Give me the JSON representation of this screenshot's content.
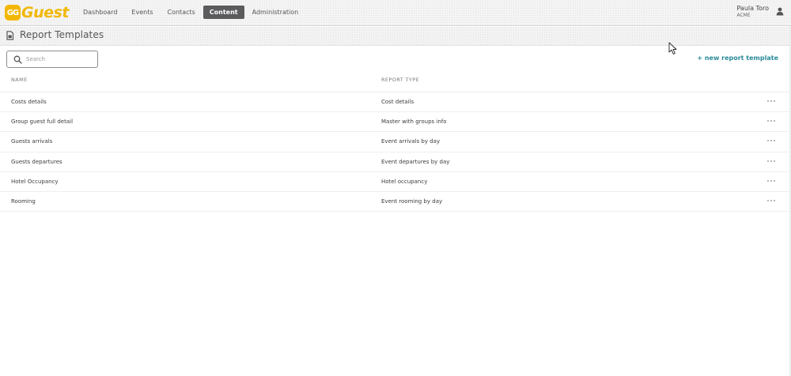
{
  "app": {
    "logo_text": "Guest",
    "logo_badge": "GG"
  },
  "nav": {
    "items": [
      {
        "label": "Dashboard",
        "active": false
      },
      {
        "label": "Events",
        "active": false
      },
      {
        "label": "Contacts",
        "active": false
      },
      {
        "label": "Content",
        "active": true
      },
      {
        "label": "Administration",
        "active": false
      }
    ]
  },
  "user": {
    "name": "Paula Toro",
    "org": "ACME",
    "icon": "person-icon"
  },
  "page": {
    "title": "Report Templates",
    "icon": "report-icon"
  },
  "search": {
    "placeholder": "Search",
    "value": ""
  },
  "actions": {
    "new_template": "+ new report template"
  },
  "table": {
    "headers": {
      "name": "NAME",
      "type": "REPORT TYPE"
    },
    "rows": [
      {
        "name": "Costs details",
        "type": "Cost details"
      },
      {
        "name": "Group guest full detail",
        "type": "Master with groups info"
      },
      {
        "name": "Guests arrivals",
        "type": "Event arrivals by day"
      },
      {
        "name": "Guests departures",
        "type": "Event departures by day"
      },
      {
        "name": "Hotel Occupancy",
        "type": "Hotel occupancy"
      },
      {
        "name": "Rooming",
        "type": "Event rooming by day"
      }
    ]
  },
  "colors": {
    "brand": "#f2b705",
    "accent": "#2a8a99",
    "nav_active": "#5b5b5e"
  }
}
